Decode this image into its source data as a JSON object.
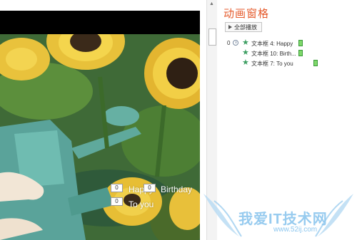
{
  "colors": {
    "accent": "#e55a2b",
    "effect_star": "#3e9f63",
    "timing_bar": "#7fd86a",
    "watermark": "#8cc6ee"
  },
  "slide": {
    "placeholders": [
      {
        "tag": "0",
        "text": "Happy"
      },
      {
        "tag": "0",
        "text": "Birthday"
      },
      {
        "tag": "0",
        "text": "To you"
      }
    ]
  },
  "animation_pane": {
    "title": "动画窗格",
    "play_all_label": "全部播放",
    "items": [
      {
        "number": "0",
        "icon": "star-effect-icon",
        "label": "文本框 4: Happy"
      },
      {
        "number": "",
        "icon": "star-effect-icon",
        "label": "文本框 10: Birth..."
      },
      {
        "number": "",
        "icon": "star-effect-icon",
        "label": "文本框 7: To you"
      }
    ]
  },
  "watermark": {
    "text": "我爱IT技术网",
    "sub": "www.52ij.com"
  }
}
